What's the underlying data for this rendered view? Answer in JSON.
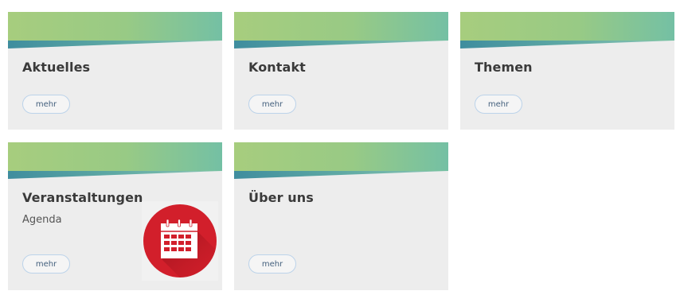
{
  "colors": {
    "card_bg": "#ededed",
    "banner_green": "#a7cd7e",
    "banner_teal": "#74c0a4",
    "banner_blue": "#3f8d9e",
    "button_border": "#bcd3ea",
    "button_text": "#44607d",
    "calendar_red": "#d21f2b"
  },
  "cards": [
    {
      "title": "Aktuelles",
      "button_label": "mehr"
    },
    {
      "title": "Kontakt",
      "button_label": "mehr"
    },
    {
      "title": "Themen",
      "button_label": "mehr"
    },
    {
      "title": "Veranstaltungen",
      "subtitle": "Agenda",
      "button_label": "mehr",
      "icon": "calendar-icon"
    },
    {
      "title": "Über uns",
      "button_label": "mehr"
    }
  ]
}
